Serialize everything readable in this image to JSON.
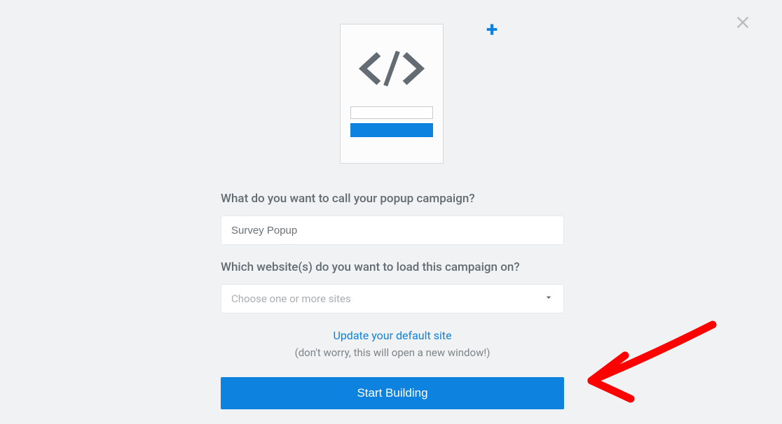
{
  "form": {
    "name_label": "What do you want to call your popup campaign?",
    "name_value": "Survey Popup",
    "site_label": "Which website(s) do you want to load this campaign on?",
    "site_placeholder": "Choose one or more sites",
    "default_site_link": "Update your default site",
    "hint": "(don't worry, this will open a new window!)",
    "submit_label": "Start Building"
  }
}
